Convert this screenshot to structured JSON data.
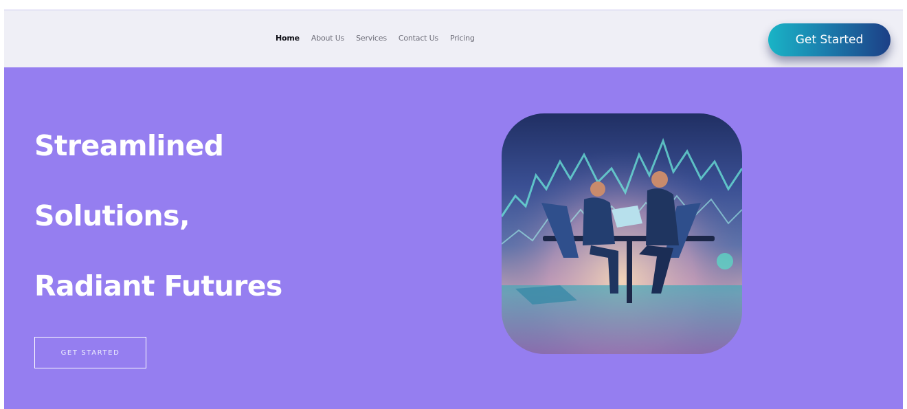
{
  "nav": {
    "links": [
      {
        "label": "Home",
        "active": true
      },
      {
        "label": "About Us",
        "active": false
      },
      {
        "label": "Services",
        "active": false
      },
      {
        "label": "Contact Us",
        "active": false
      },
      {
        "label": "Pricing",
        "active": false
      }
    ],
    "cta_label": "Get Started"
  },
  "hero": {
    "headline_lines": [
      "Streamlined",
      "Solutions,",
      "Radiant Futures"
    ],
    "cta_label": "GET STARTED",
    "illustration": "business-meeting-illustration"
  },
  "colors": {
    "navbar_bg": "#efeff6",
    "hero_bg": "#957ef0",
    "button_gradient_start": "#19b4c6",
    "button_gradient_end": "#1c3f86",
    "headline_text": "#ffffff"
  }
}
